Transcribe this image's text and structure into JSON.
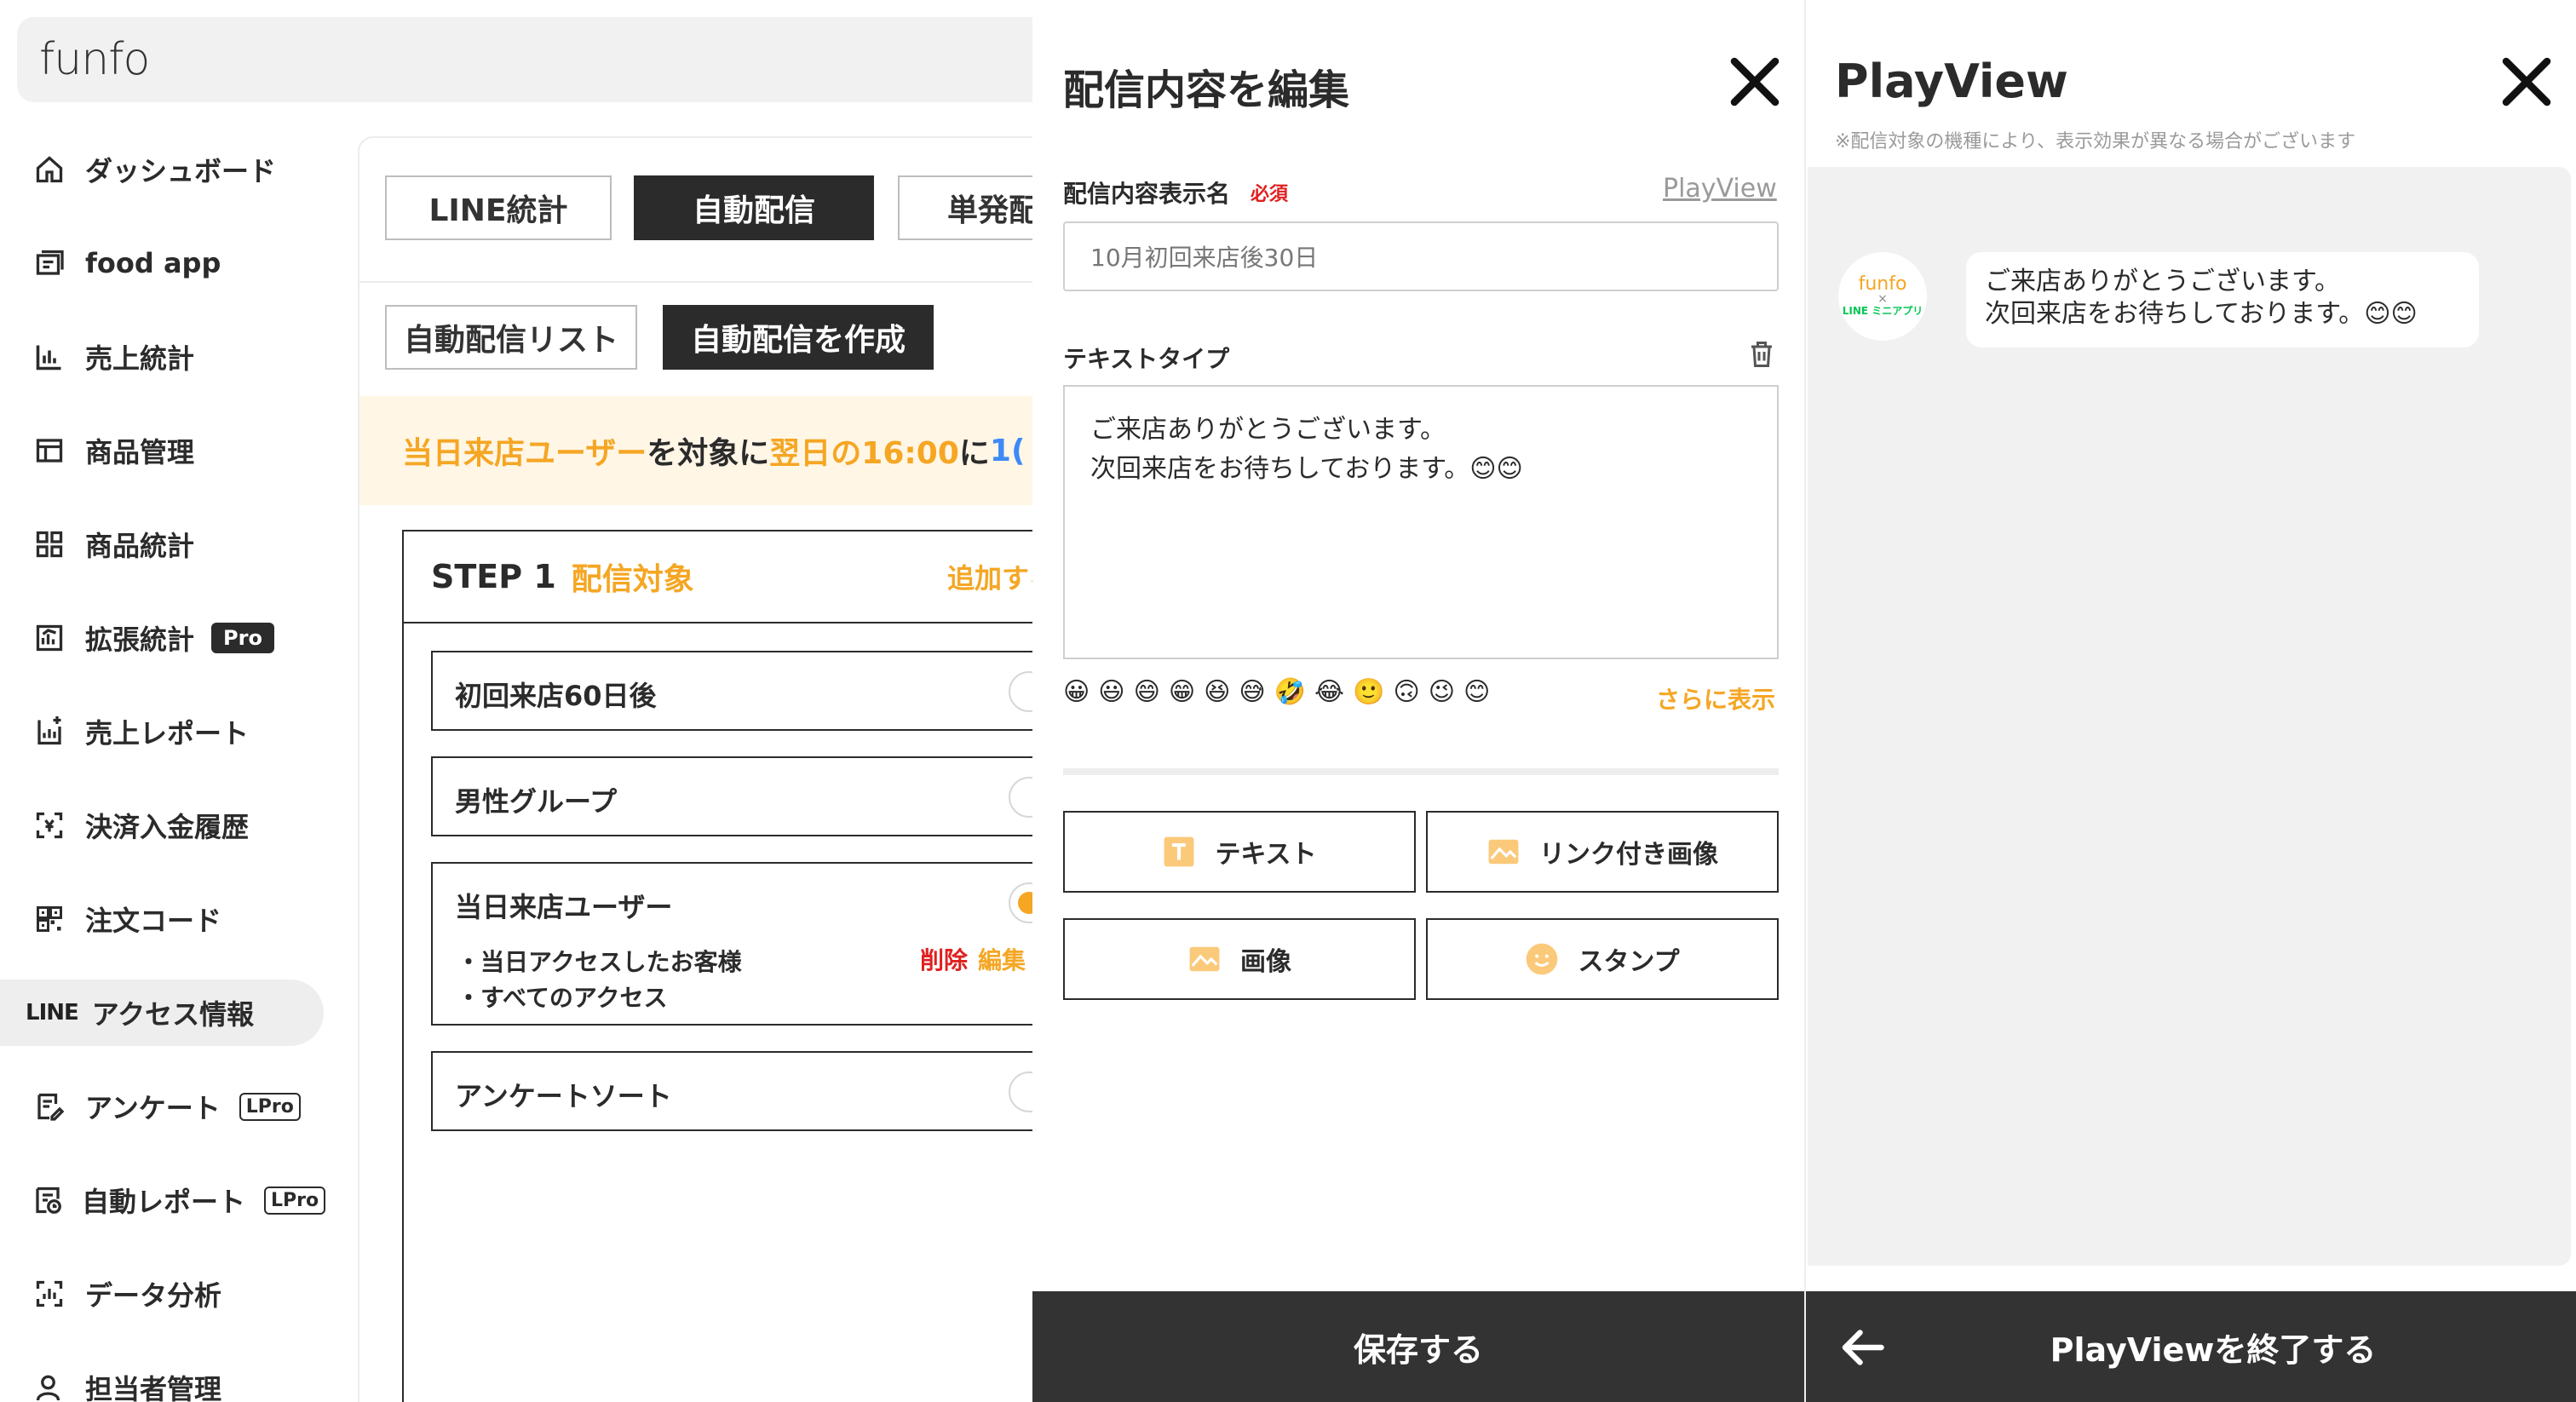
{
  "app": {
    "logo": "funfo",
    "sidebar": [
      {
        "label": "ダッシュボード",
        "icon": "home-icon"
      },
      {
        "label": "food app",
        "icon": "food-app-icon"
      },
      {
        "label": "売上統計",
        "icon": "bar-chart-icon"
      },
      {
        "label": "商品管理",
        "icon": "product-manage-icon"
      },
      {
        "label": "商品統計",
        "icon": "grid-icon"
      },
      {
        "label": "拡張統計",
        "icon": "extended-stats-icon",
        "badge": "Pro"
      },
      {
        "label": "売上レポート",
        "icon": "sales-report-icon"
      },
      {
        "label": "決済入金履歴",
        "icon": "payment-history-icon"
      },
      {
        "label": "注文コード",
        "icon": "qr-code-icon"
      },
      {
        "label": "アクセス情報",
        "icon": "line-logo",
        "prefix": "LINE",
        "active": true
      },
      {
        "label": "アンケート",
        "icon": "survey-icon",
        "badge": "LPro"
      },
      {
        "label": "自動レポート",
        "icon": "auto-report-icon",
        "badge": "LPro"
      },
      {
        "label": "データ分析",
        "icon": "data-analysis-icon"
      },
      {
        "label": "担当者管理",
        "icon": "staff-icon"
      }
    ],
    "tabs": [
      "LINE統計",
      "自動配信",
      "単発配信"
    ],
    "subtabs": [
      "自動配信リスト",
      "自動配信を作成"
    ],
    "banner": {
      "part1": "当日来店ユーザー",
      "part2": "を対象に",
      "part3": "翌日の16:00",
      "part4": "に",
      "part5": "1("
    },
    "step": {
      "num": "STEP 1",
      "title": "配信対象",
      "add": "追加する"
    },
    "options": [
      {
        "label": "初回来店60日後",
        "checked": false
      },
      {
        "label": "男性グループ",
        "checked": false
      },
      {
        "label": "当日来店ユーザー",
        "checked": true,
        "details": [
          "・当日アクセスしたお客様",
          "・すべてのアクセス"
        ],
        "delete": "削除",
        "edit": "編集"
      },
      {
        "label": "アンケートソート",
        "checked": false
      }
    ]
  },
  "edit_panel": {
    "title": "配信内容を編集",
    "name_label": "配信内容表示名",
    "required": "必須",
    "playview_link": "PlayView",
    "name_value": "10月初回来店後30日",
    "text_type_label": "テキストタイプ",
    "message": "ご来店ありがとうございます。\n次回来店をお待ちしております。😊😊",
    "emojis": [
      "😀",
      "😃",
      "😄",
      "😁",
      "😆",
      "😅",
      "🤣",
      "😂",
      "🙂",
      "🙃",
      "😉",
      "😊"
    ],
    "more": "さらに表示",
    "buttons": [
      {
        "label": "テキスト",
        "icon": "text-type-icon"
      },
      {
        "label": "リンク付き画像",
        "icon": "link-image-icon"
      },
      {
        "label": "画像",
        "icon": "image-icon"
      },
      {
        "label": "スタンプ",
        "icon": "stamp-icon"
      }
    ],
    "save": "保存する"
  },
  "playview": {
    "title": "PlayView",
    "note": "※配信対象の機種により、表示効果が異なる場合がございます",
    "avatar": {
      "top": "funfo",
      "mid": "×",
      "bottom": "LINE ミニアプリ"
    },
    "bubble": "ご来店ありがとうございます。\n次回来店をお待ちしております。😊😊",
    "end": "PlayViewを終了する"
  },
  "colors": {
    "accent": "#f5a623",
    "dark": "#2b2b2b",
    "danger": "#e02020",
    "link_blue": "#3d8af7",
    "line_green": "#06c755"
  }
}
